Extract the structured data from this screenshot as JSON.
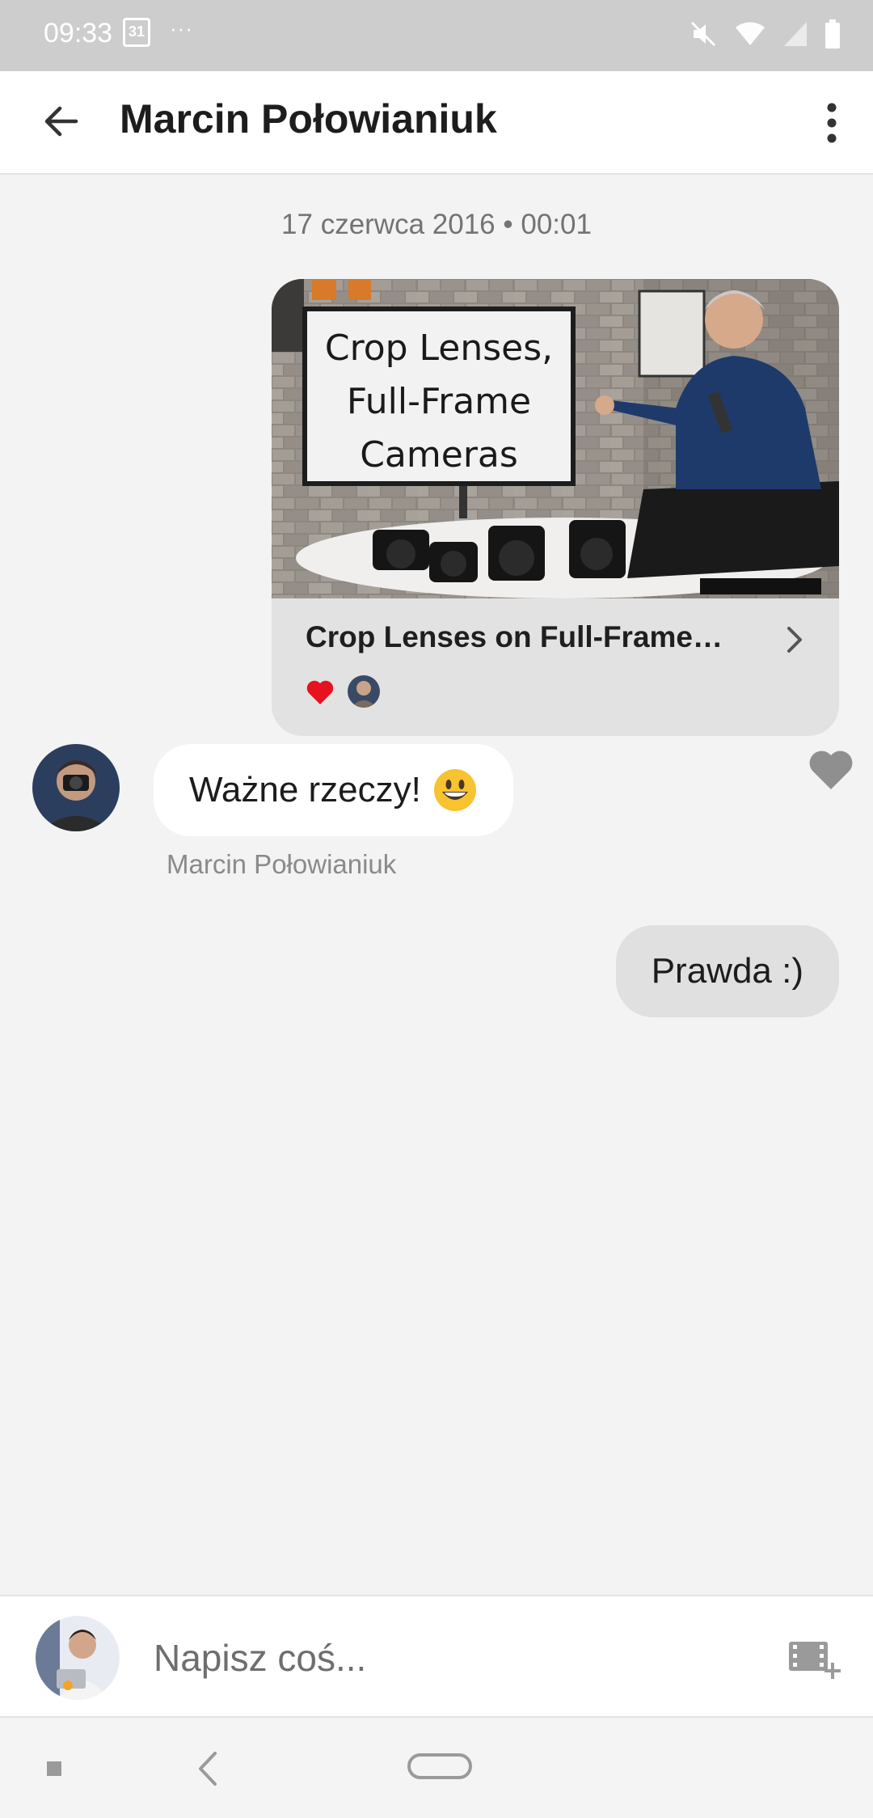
{
  "status_bar": {
    "time": "09:33",
    "calendar_day": "31",
    "more_indicator": "···"
  },
  "header": {
    "title": "Marcin Połowianiuk"
  },
  "conversation": {
    "date_label": "17 czerwca 2016 • 00:01",
    "shared_video": {
      "thumbnail_text_lines": [
        "Crop Lenses,",
        "Full-Frame",
        "Cameras"
      ],
      "title": "Crop Lenses on Full-Frame…"
    },
    "incoming_message": {
      "text": "Ważne rzeczy!",
      "sender": "Marcin Połowianiuk"
    },
    "outgoing_message": {
      "text": "Prawda :)"
    }
  },
  "composer": {
    "placeholder": "Napisz coś..."
  },
  "colors": {
    "background": "#f3f3f3",
    "heart_red": "#e8121f",
    "heart_gray": "#8f8f8f"
  }
}
